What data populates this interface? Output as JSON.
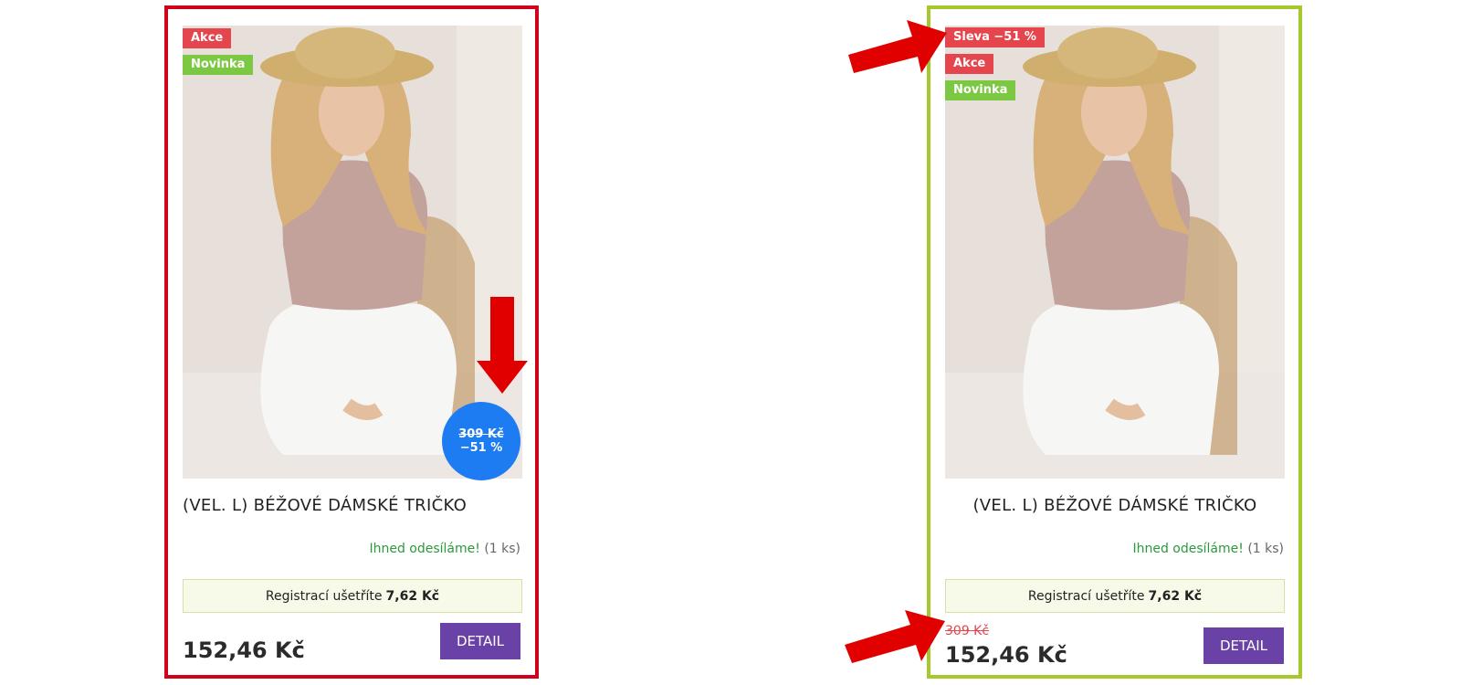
{
  "cards": {
    "left": {
      "badges": [
        "Akce",
        "Novinka"
      ],
      "discount_circle": {
        "old_price": "309 Kč",
        "percent": "−51 %"
      },
      "title": "(VEL. L) BÉŽOVÉ DÁMSKÉ TRIČKO",
      "stock": {
        "status": "Ihned odesíláme!",
        "qty": "(1 ks)"
      },
      "registration": {
        "text": "Registrací ušetříte",
        "amount": "7,62  Kč"
      },
      "price": "152,46 Kč",
      "detail_button": "DETAIL"
    },
    "right": {
      "badges": [
        "Sleva −51 %",
        "Akce",
        "Novinka"
      ],
      "title": "(VEL. L) BÉŽOVÉ DÁMSKÉ TRIČKO",
      "stock": {
        "status": "Ihned odesíláme!",
        "qty": "(1 ks)"
      },
      "registration": {
        "text": "Registrací ušetříte",
        "amount": "7,62  Kč"
      },
      "old_price": "309 Kč",
      "price": "152,46 Kč",
      "detail_button": "DETAIL"
    }
  },
  "colors": {
    "left_frame": "#d0021b",
    "right_frame": "#a5c82c",
    "badge_red": "#e5454c",
    "badge_green": "#7cc843",
    "discount_circle": "#1e7cf2",
    "detail_button": "#6a41a6",
    "in_stock": "#2a9a3c",
    "arrow": "#e00000"
  }
}
